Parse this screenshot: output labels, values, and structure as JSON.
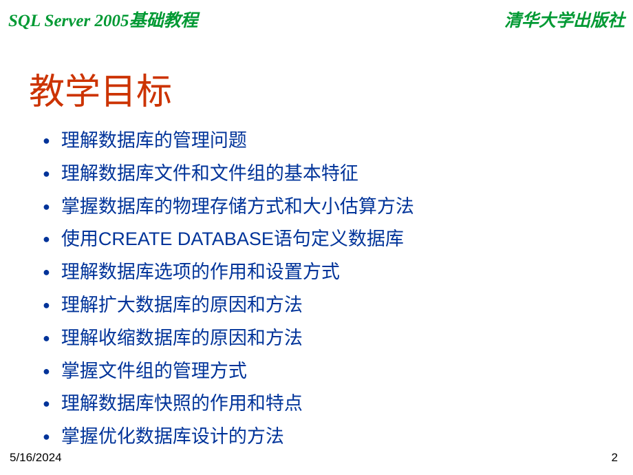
{
  "header": {
    "left": "SQL Server 2005基础教程",
    "right": "清华大学出版社"
  },
  "title": "教学目标",
  "bullets": [
    "理解数据库的管理问题",
    "理解数据库文件和文件组的基本特征",
    "掌握数据库的物理存储方式和大小估算方法",
    "使用CREATE DATABASE语句定义数据库",
    "理解数据库选项的作用和设置方式",
    "理解扩大数据库的原因和方法",
    "理解收缩数据库的原因和方法",
    "掌握文件组的管理方式",
    "理解数据库快照的作用和特点",
    "掌握优化数据库设计的方法"
  ],
  "footer": {
    "date": "5/16/2024",
    "page": "2"
  }
}
